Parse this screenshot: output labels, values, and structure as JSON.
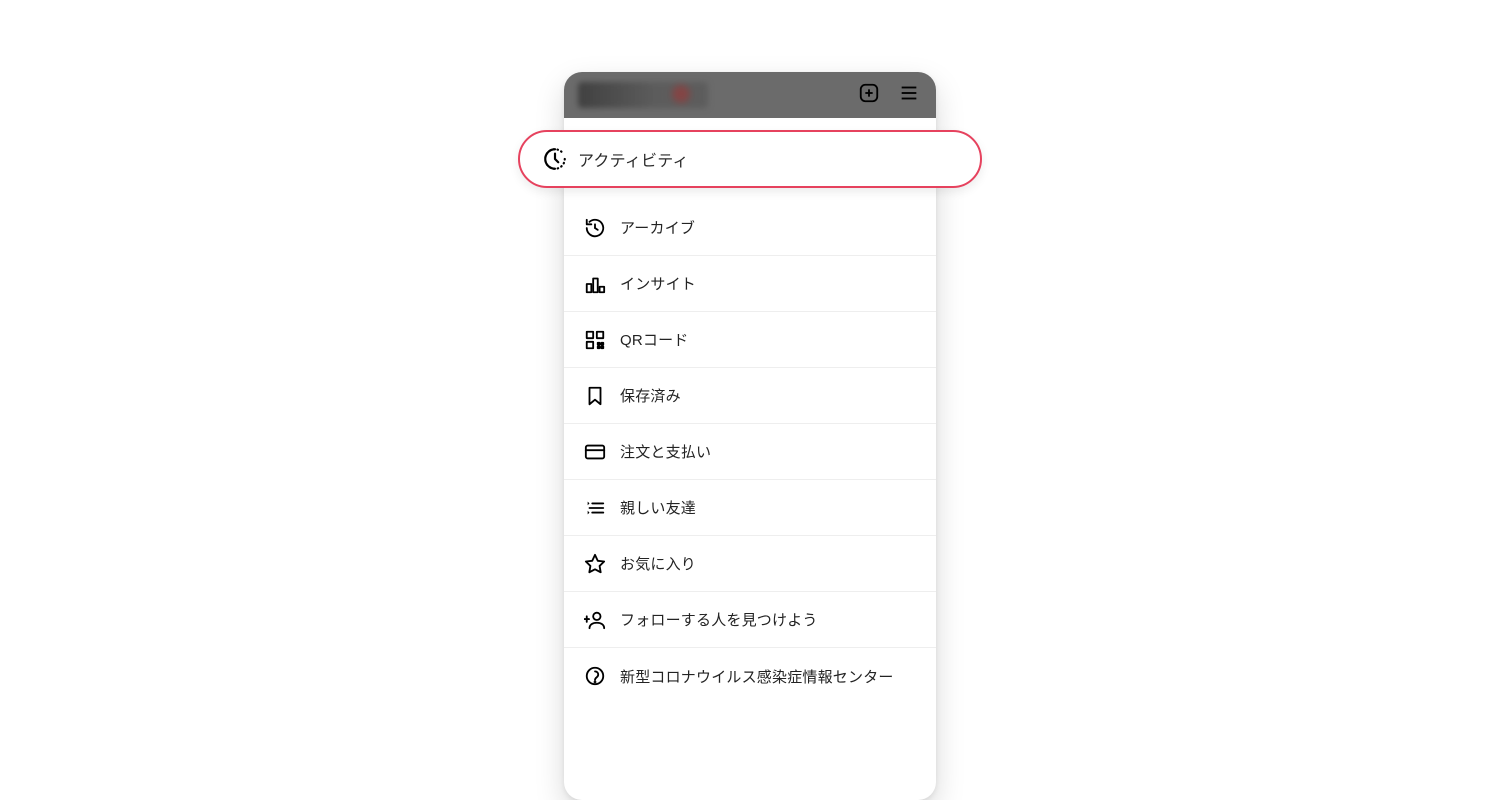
{
  "highlight": {
    "label": "アクティビティ"
  },
  "menu": {
    "items": [
      {
        "label": "アーカイブ"
      },
      {
        "label": "インサイト"
      },
      {
        "label": "QRコード"
      },
      {
        "label": "保存済み"
      },
      {
        "label": "注文と支払い"
      },
      {
        "label": "親しい友達"
      },
      {
        "label": "お気に入り"
      },
      {
        "label": "フォローする人を見つけよう"
      },
      {
        "label": "新型コロナウイルス感染症情報センター"
      }
    ]
  },
  "colors": {
    "highlight_border": "#e6425e"
  }
}
